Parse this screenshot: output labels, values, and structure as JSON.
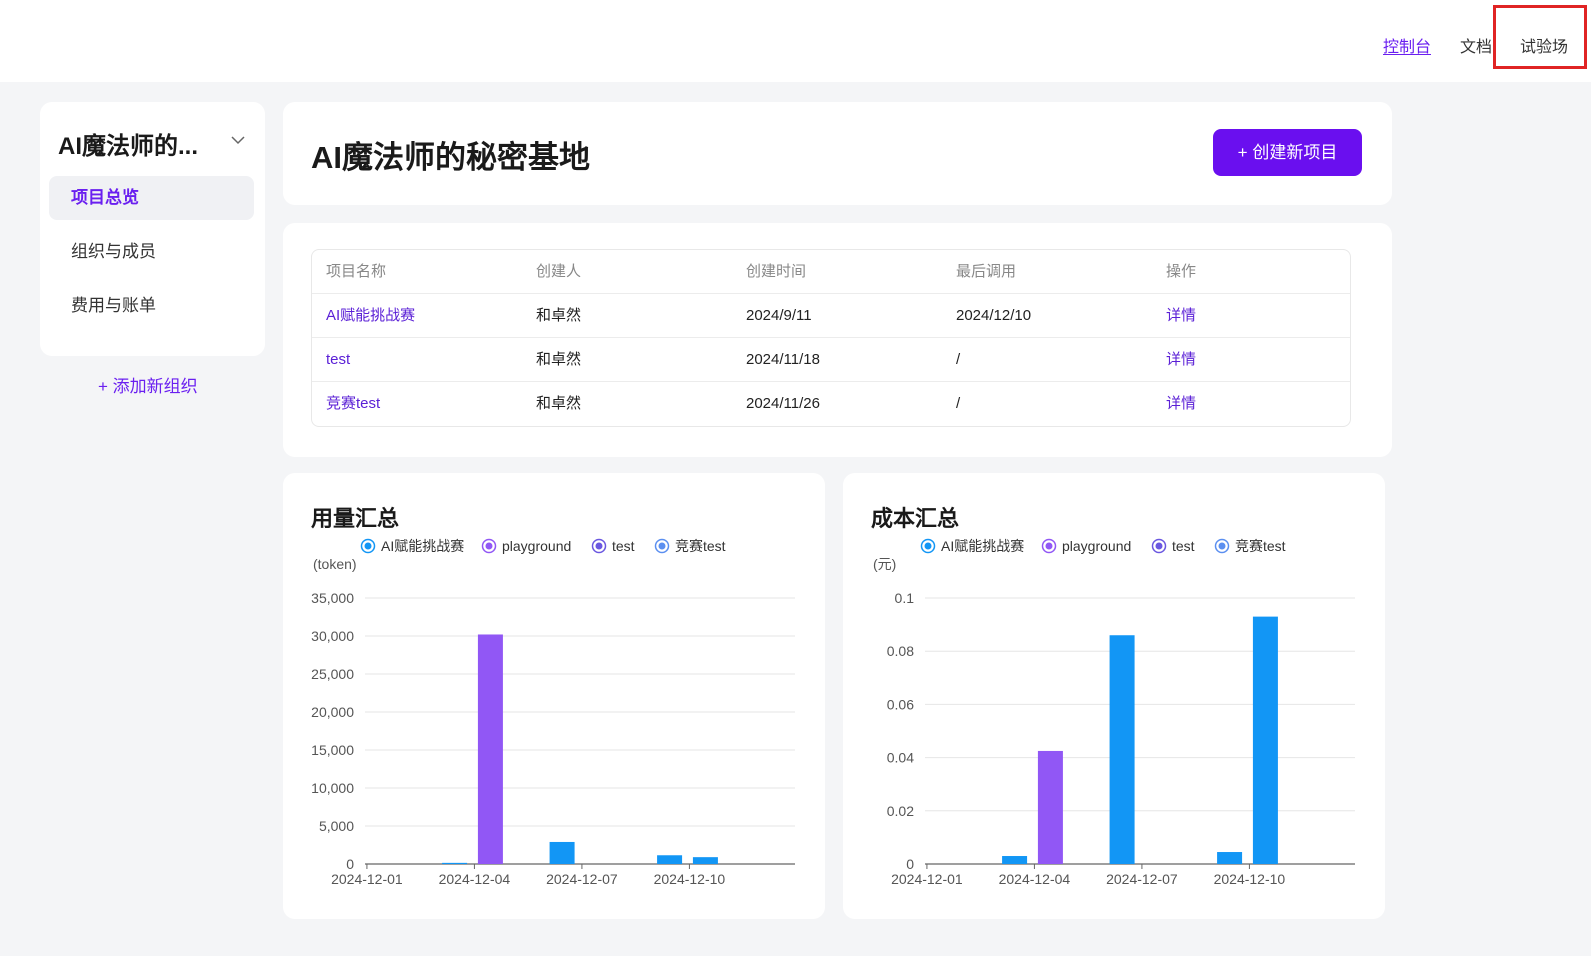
{
  "topnav": {
    "console": "控制台",
    "docs": "文档",
    "playground": "试验场"
  },
  "sidebar": {
    "org_name": "AI魔法师的...",
    "items": [
      {
        "label": "项目总览",
        "active": true
      },
      {
        "label": "组织与成员",
        "active": false
      },
      {
        "label": "费用与账单",
        "active": false
      }
    ],
    "add_org": "+  添加新组织"
  },
  "header": {
    "title": "AI魔法师的秘密基地",
    "create_button": "+ 创建新项目"
  },
  "projects_table": {
    "columns": [
      "项目名称",
      "创建人",
      "创建时间",
      "最后调用",
      "操作"
    ],
    "rows": [
      {
        "name": "AI赋能挑战赛",
        "creator": "和卓然",
        "created": "2024/9/11",
        "last_call": "2024/12/10",
        "action": "详情"
      },
      {
        "name": "test",
        "creator": "和卓然",
        "created": "2024/11/18",
        "last_call": "/",
        "action": "详情"
      },
      {
        "name": "竞赛test",
        "creator": "和卓然",
        "created": "2024/11/26",
        "last_call": "/",
        "action": "详情"
      }
    ]
  },
  "colors": {
    "accent": "#6a0fef",
    "series_ai": "#1296f5",
    "series_playground": "#9157f5",
    "series_test": "#6a57e0",
    "series_competition": "#5b8ff0"
  },
  "chart_data": [
    {
      "type": "bar",
      "title": "用量汇总",
      "ylabel": "(token)",
      "xlabel": "",
      "ylim": [
        0,
        35000
      ],
      "yticks": [
        0,
        5000,
        10000,
        15000,
        20000,
        25000,
        30000,
        35000
      ],
      "ytick_labels": [
        "0",
        "5,000",
        "10,000",
        "15,000",
        "20,000",
        "25,000",
        "30,000",
        "35,000"
      ],
      "categories": [
        "2024-12-01",
        "2024-12-02",
        "2024-12-03",
        "2024-12-04",
        "2024-12-05",
        "2024-12-06",
        "2024-12-07",
        "2024-12-08",
        "2024-12-09",
        "2024-12-10",
        "2024-12-11",
        "2024-12-12"
      ],
      "xtick_labels": [
        "2024-12-01",
        "2024-12-04",
        "2024-12-07",
        "2024-12-10"
      ],
      "legend_position": "top-left",
      "series": [
        {
          "name": "AI赋能挑战赛",
          "values": [
            0,
            0,
            150,
            0,
            0,
            2900,
            0,
            0,
            1150,
            900,
            0,
            0
          ]
        },
        {
          "name": "playground",
          "values": [
            0,
            0,
            0,
            30200,
            0,
            0,
            0,
            0,
            0,
            0,
            0,
            0
          ]
        },
        {
          "name": "test",
          "values": [
            0,
            0,
            0,
            0,
            0,
            0,
            0,
            0,
            0,
            0,
            0,
            0
          ]
        },
        {
          "name": "竞赛test",
          "values": [
            0,
            0,
            0,
            0,
            0,
            0,
            0,
            0,
            0,
            0,
            0,
            0
          ]
        }
      ]
    },
    {
      "type": "bar",
      "title": "成本汇总",
      "ylabel": "(元)",
      "xlabel": "",
      "ylim": [
        0,
        0.1
      ],
      "yticks": [
        0,
        0.02,
        0.04,
        0.06,
        0.08,
        0.1
      ],
      "ytick_labels": [
        "0",
        "0.02",
        "0.04",
        "0.06",
        "0.08",
        "0.1"
      ],
      "categories": [
        "2024-12-01",
        "2024-12-02",
        "2024-12-03",
        "2024-12-04",
        "2024-12-05",
        "2024-12-06",
        "2024-12-07",
        "2024-12-08",
        "2024-12-09",
        "2024-12-10",
        "2024-12-11",
        "2024-12-12"
      ],
      "xtick_labels": [
        "2024-12-01",
        "2024-12-04",
        "2024-12-07",
        "2024-12-10"
      ],
      "legend_position": "top-left",
      "series": [
        {
          "name": "AI赋能挑战赛",
          "values": [
            0,
            0,
            0.003,
            0,
            0,
            0.086,
            0,
            0,
            0.0045,
            0.093,
            0,
            0
          ]
        },
        {
          "name": "playground",
          "values": [
            0,
            0,
            0,
            0.0425,
            0,
            0,
            0,
            0,
            0,
            0,
            0,
            0
          ]
        },
        {
          "name": "test",
          "values": [
            0,
            0,
            0,
            0,
            0,
            0,
            0,
            0,
            0,
            0,
            0,
            0
          ]
        },
        {
          "name": "竞赛test",
          "values": [
            0,
            0,
            0,
            0,
            0,
            0,
            0,
            0,
            0,
            0,
            0,
            0
          ]
        }
      ]
    }
  ]
}
